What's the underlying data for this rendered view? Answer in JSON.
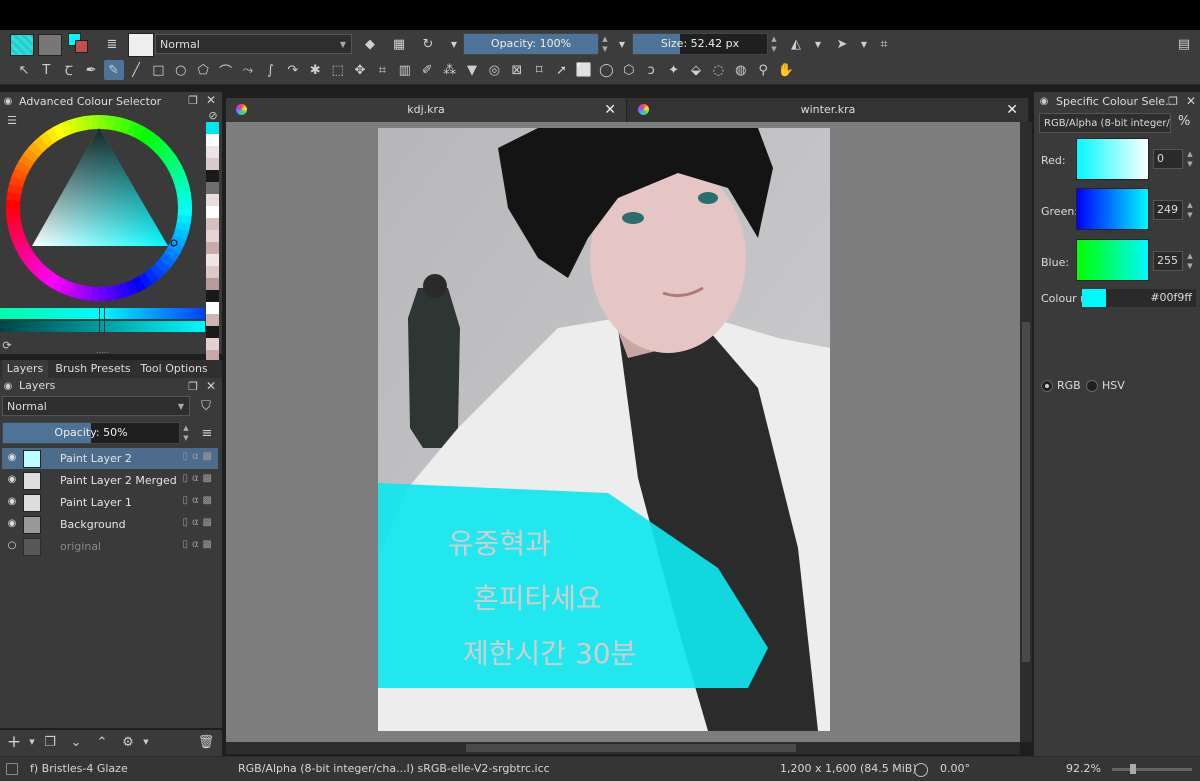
{
  "toolbar": {
    "blend_mode": "Normal",
    "opacity_label": "Opacity: 100%",
    "opacity_value": 1.0,
    "size_label": "Size: 52.42 px",
    "size_fill": 0.35
  },
  "tools": [
    "select-icon",
    "text-icon",
    "freehand-text-icon",
    "calligraphy-icon",
    "brush-icon",
    "line-icon",
    "rectangle-icon",
    "ellipse-icon",
    "polygon-icon",
    "polyline-icon",
    "bezier-icon",
    "freehand-path-icon",
    "dynamic-brush-icon",
    "multibrush-icon",
    "transform-icon",
    "move-icon",
    "crop-icon",
    "gradient-icon",
    "color-picker-icon",
    "smart-patch-icon",
    "fill-icon",
    "assistant-icon",
    "perspective-grid-icon",
    "reference-icon",
    "measure-icon",
    "rect-select-icon",
    "ellipse-select-icon",
    "polygon-select-icon",
    "freehand-select-icon",
    "contiguous-select-icon",
    "similar-select-icon",
    "bezier-select-icon",
    "magnetic-select-icon",
    "zoom-icon",
    "pan-icon"
  ],
  "colour_selector": {
    "title": "Advanced Colour Selector",
    "palette": [
      "#00e5f0",
      "#ffffff",
      "#ece4e4",
      "#d9c9c9",
      "#1a1a1a",
      "#6e6e6e",
      "#e8dcdc",
      "#ffffff",
      "#d8c0c0",
      "#e6d4d4",
      "#c9aaaa",
      "#f0e4e4",
      "#dcc8c8",
      "#b89a9a",
      "#1a1a1a",
      "#ffffff",
      "#d0b4b4",
      "#1a1a1a",
      "#e4d0d0",
      "#c8a8a8"
    ]
  },
  "panel_tabs": [
    "Layers",
    "Brush Presets",
    "Tool Options"
  ],
  "layers_panel": {
    "title": "Layers",
    "blend_mode": "Normal",
    "opacity_label": "Opacity:  50%",
    "opacity_value": 0.5,
    "layers": [
      {
        "name": "Paint Layer 2",
        "selected": true,
        "visible": true
      },
      {
        "name": "Paint Layer 2 Merged",
        "selected": false,
        "visible": true
      },
      {
        "name": "Paint Layer 1",
        "selected": false,
        "visible": true
      },
      {
        "name": "Background",
        "selected": false,
        "visible": true
      },
      {
        "name": "original",
        "selected": false,
        "visible": false
      }
    ]
  },
  "documents": {
    "tab1": "kdj.kra",
    "tab2": "winter.kra"
  },
  "artwork": {
    "text_lines": [
      "유중혁과",
      "혼피타세요",
      "제한시간 30분"
    ]
  },
  "specific_colour": {
    "title": "Specific Colour Sele...",
    "model": "RGB/Alpha (8-bit integer/...",
    "percent_symbol": "%",
    "red_label": "Red:",
    "red_value": "0",
    "green_label": "Green:",
    "green_value": "249",
    "blue_label": "Blue:",
    "blue_value": "255",
    "colour_name_label": "Colour na",
    "hex": "#00f9ff",
    "radio_rgb": "RGB",
    "radio_hsv": "HSV"
  },
  "statusbar": {
    "brush": "f) Bristles-4 Glaze",
    "colorspace": "RGB/Alpha (8-bit integer/cha...l)  sRGB-elle-V2-srgbtrc.icc",
    "image_size": "1,200 x 1,600 (84.5 MiB)",
    "rotation": "0.00°",
    "zoom": "92.2%"
  },
  "colors": {
    "accent": "#4d7398",
    "fg_colour": "#00f9ff"
  }
}
